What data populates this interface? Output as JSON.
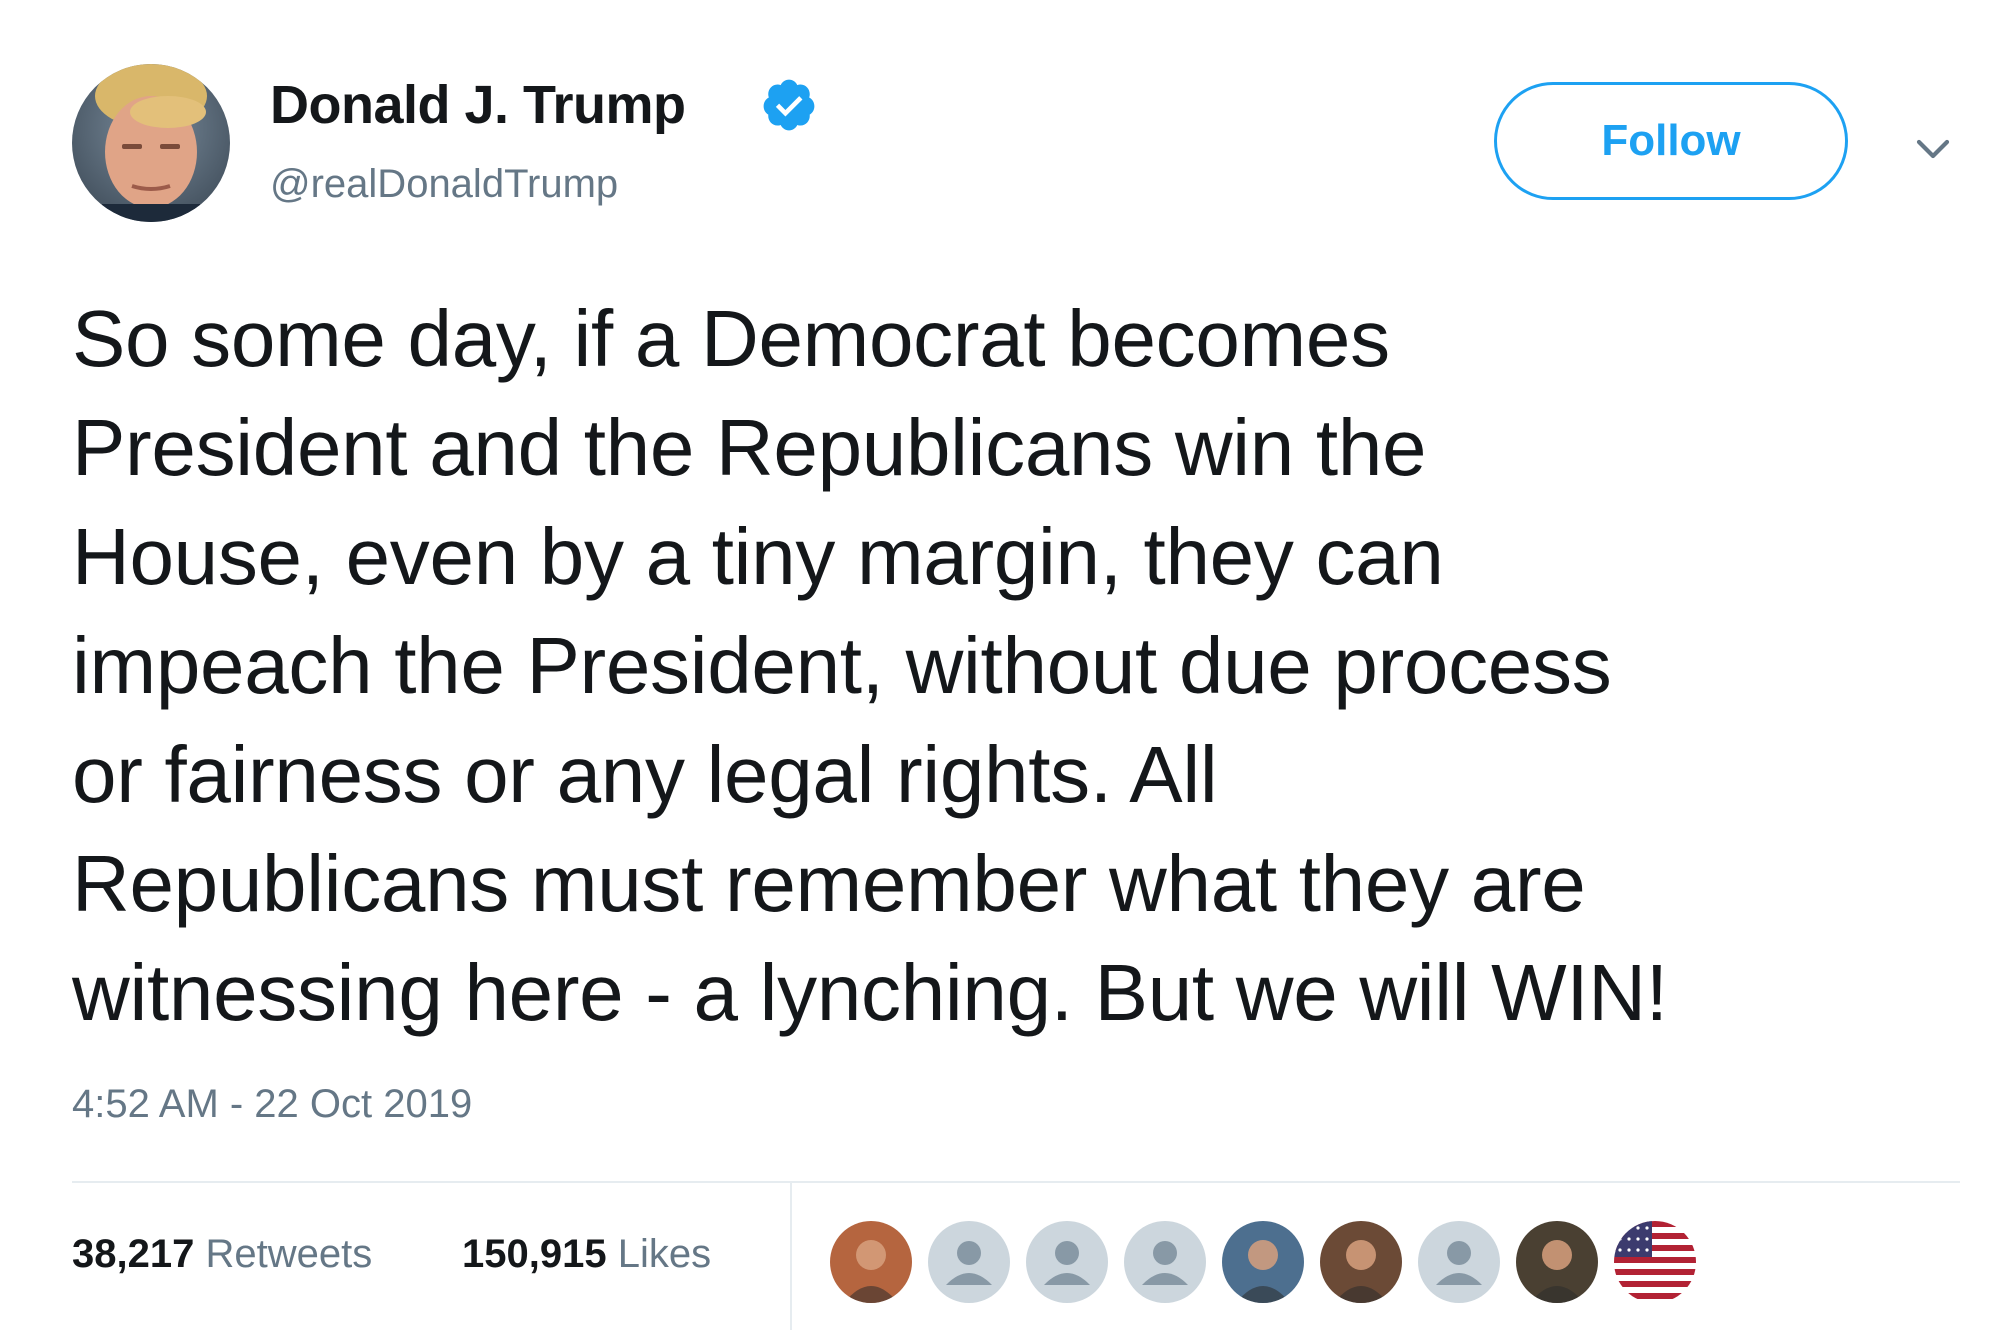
{
  "tweet": {
    "author": {
      "display_name": "Donald J. Trump",
      "handle": "@realDonaldTrump",
      "verified": true,
      "avatar_icon": "profile-photo"
    },
    "follow_label": "Follow",
    "menu_icon": "chevron-down-icon",
    "text_lines": [
      "So some day, if a Democrat becomes",
      "President and the Republicans win the",
      "House, even by a tiny margin, they can",
      "impeach the President, without due process",
      "or fairness or any legal rights. All",
      "Republicans must remember what they are",
      "witnessing here - a lynching. But we will WIN!"
    ],
    "timestamp": "4:52 AM - 22 Oct 2019",
    "stats": {
      "retweets_count": "38,217",
      "retweets_label": "Retweets",
      "likes_count": "150,915",
      "likes_label": "Likes"
    },
    "likers": [
      {
        "kind": "photo",
        "color": "#b5653f"
      },
      {
        "kind": "default",
        "color": "#ccd6dd"
      },
      {
        "kind": "default",
        "color": "#ccd6dd"
      },
      {
        "kind": "default",
        "color": "#ccd6dd"
      },
      {
        "kind": "photo",
        "color": "#4d6f8f"
      },
      {
        "kind": "photo",
        "color": "#6b4a36"
      },
      {
        "kind": "default",
        "color": "#ccd6dd"
      },
      {
        "kind": "photo",
        "color": "#4a4032"
      },
      {
        "kind": "flag",
        "color": "#b22234"
      }
    ]
  },
  "colors": {
    "accent": "#1da1f2",
    "text": "#14171a",
    "secondary_text": "#657786",
    "divider": "#e6ecf0"
  }
}
